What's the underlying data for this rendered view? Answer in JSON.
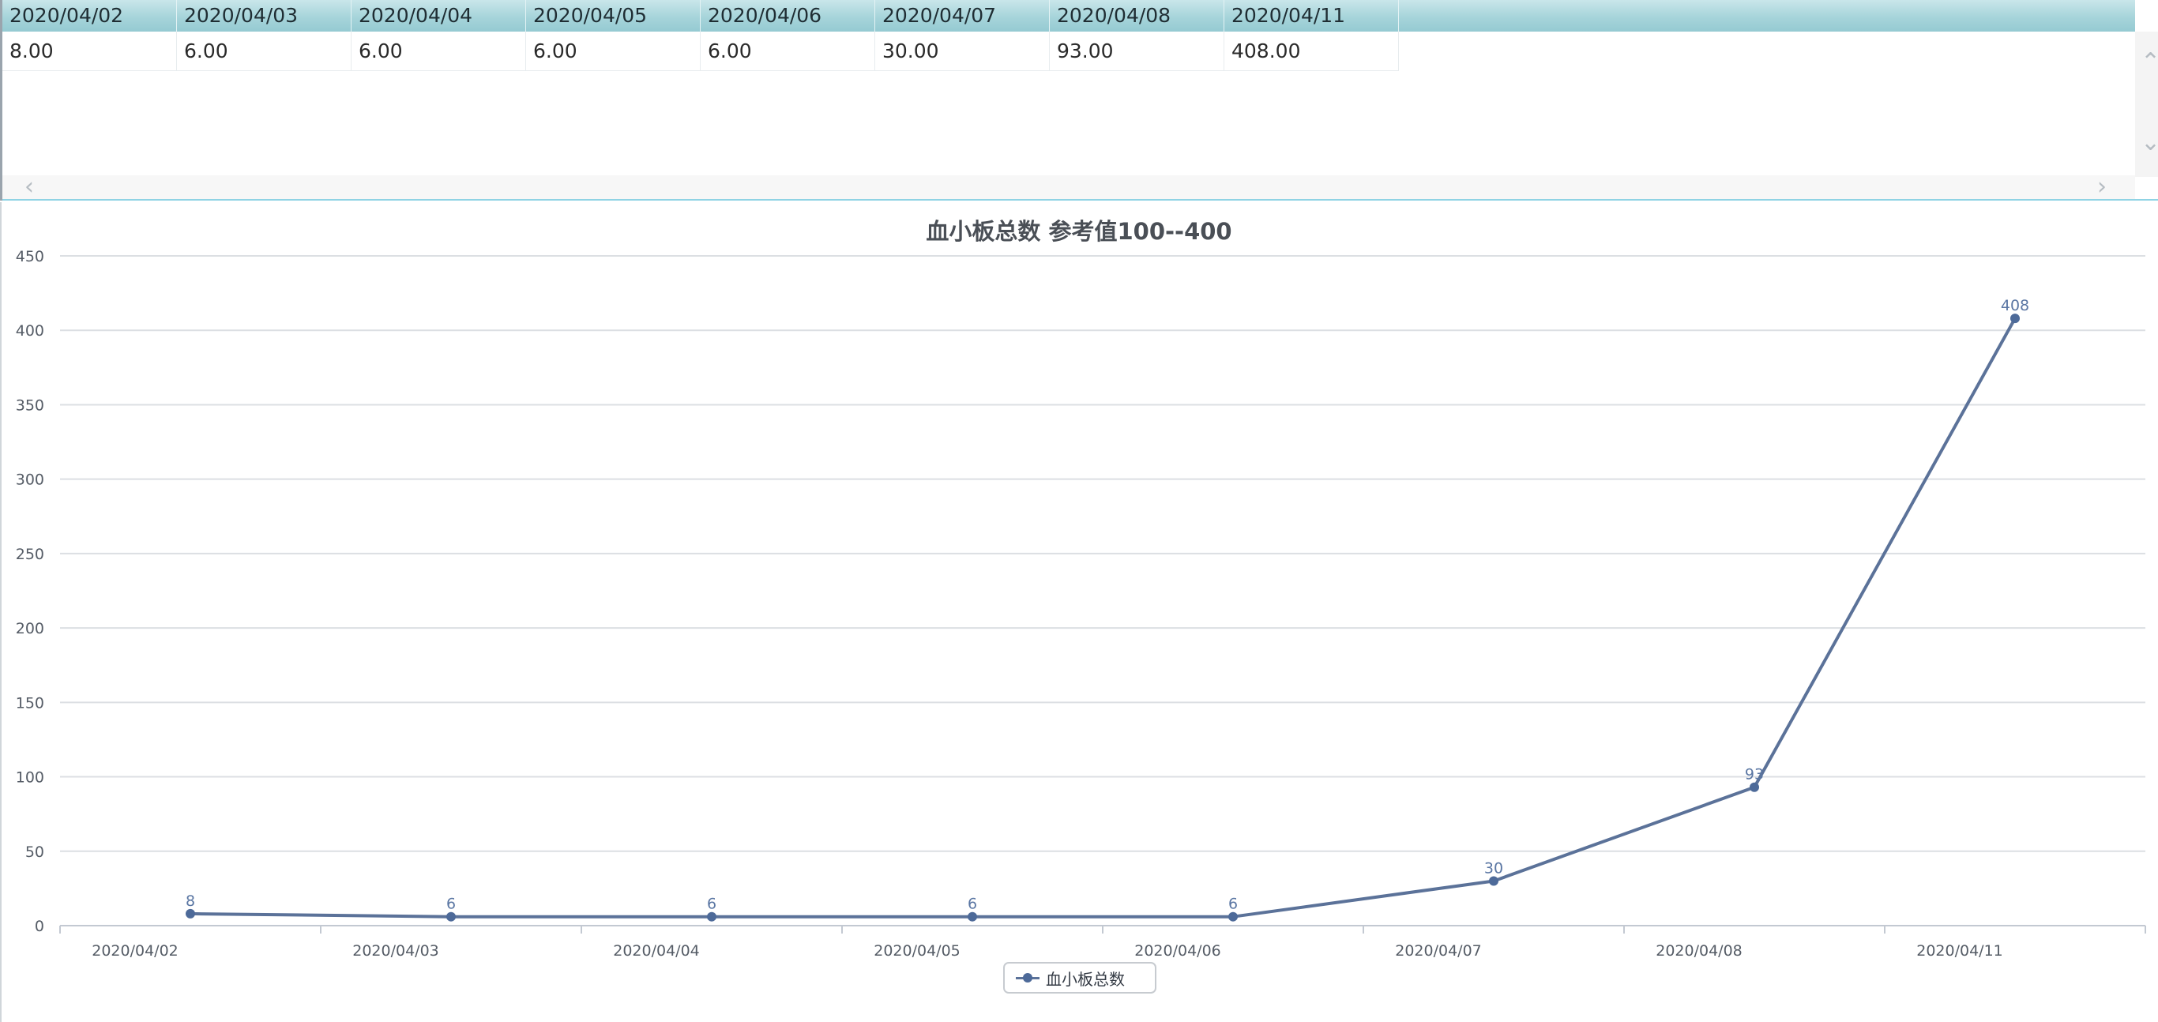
{
  "table": {
    "headers": [
      "2020/04/02",
      "2020/04/03",
      "2020/04/04",
      "2020/04/05",
      "2020/04/06",
      "2020/04/07",
      "2020/04/08",
      "2020/04/11"
    ],
    "row": [
      "8.00",
      "6.00",
      "6.00",
      "6.00",
      "6.00",
      "30.00",
      "93.00",
      "408.00"
    ]
  },
  "scrollbars": {
    "up_icon": "chevron-up-icon",
    "down_icon": "chevron-down-icon",
    "left_icon": "chevron-left-icon",
    "right_icon": "chevron-right-icon"
  },
  "chart_data": {
    "type": "line",
    "title": "血小板总数 参考值100--400",
    "categories": [
      "2020/04/02",
      "2020/04/03",
      "2020/04/04",
      "2020/04/05",
      "2020/04/06",
      "2020/04/07",
      "2020/04/08",
      "2020/04/11"
    ],
    "series": [
      {
        "name": "血小板总数",
        "values": [
          8,
          6,
          6,
          6,
          6,
          30,
          93,
          408
        ],
        "color": "#5b7299"
      }
    ],
    "data_labels": [
      "8",
      "6",
      "6",
      "6",
      "6",
      "30",
      "93",
      "408"
    ],
    "y_ticks": [
      0,
      50,
      100,
      150,
      200,
      250,
      300,
      350,
      400,
      450
    ],
    "ylim": [
      0,
      450
    ],
    "xlabel": "",
    "ylabel": "",
    "grid": true,
    "legend_position": "bottom-center"
  }
}
